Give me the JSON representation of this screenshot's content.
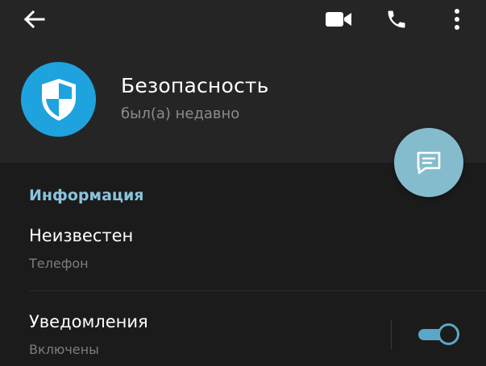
{
  "toolbar": {
    "back_icon": "arrow-left-icon",
    "video_icon": "video-camera-icon",
    "call_icon": "phone-icon",
    "more_icon": "more-vertical-icon"
  },
  "profile": {
    "name": "Безопасность",
    "status": "был(а) недавно",
    "avatar_icon": "shield-icon",
    "avatar_color": "#1ea3de"
  },
  "fab": {
    "icon": "message-icon",
    "color": "#84bccd"
  },
  "info": {
    "section_title": "Информация",
    "phone_value": "Неизвестен",
    "phone_label": "Телефон"
  },
  "notifications": {
    "title": "Уведомления",
    "status": "Включены",
    "enabled": true,
    "accent_color": "#5aa7c8"
  },
  "colors": {
    "background": "#1b1b1b",
    "header": "#252525",
    "section_title": "#8ac4dc"
  }
}
